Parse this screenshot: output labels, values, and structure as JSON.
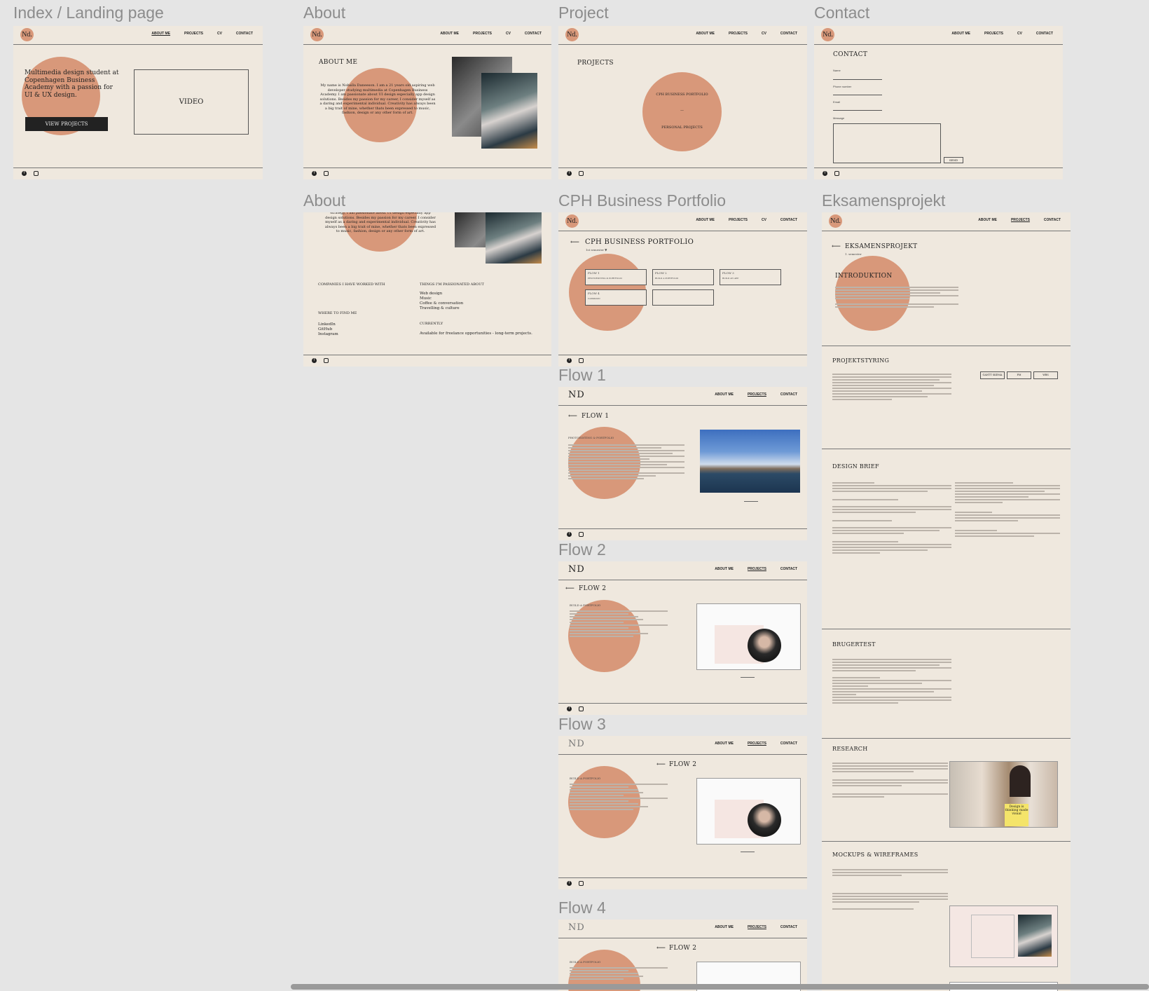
{
  "frame_labels": {
    "index": "Index / Landing page",
    "about1": "About",
    "project": "Project",
    "contact": "Contact",
    "about2": "About",
    "cph": "CPH Business Portfolio",
    "eks": "Eksamensprojekt",
    "flow1": "Flow 1",
    "flow2": "Flow 2",
    "flow3": "Flow 3",
    "flow4": "Flow 4"
  },
  "brand": {
    "logo": "Nd.",
    "accent": "#d8987a",
    "background": "#efe8de"
  },
  "nav": {
    "about": "ABOUT ME",
    "projects": "PROJECTS",
    "cv": "CV",
    "contact": "CONTACT"
  },
  "footer": {
    "icons": [
      "facebook-icon",
      "instagram-icon"
    ]
  },
  "index": {
    "tagline": "Multimedia design student at Copenhagen Business Academy with a passion for UI & UX design.",
    "cta": "VIEW PROJECTS",
    "video": "VIDEO"
  },
  "about": {
    "title": "ABOUT ME",
    "bio": "My name is Nohalla Daneeson. I am a 21 years old aspiring web developer studying multimedia at Copenhagen Business Academy. I am passionate about UI design especially app design solutions. Besides my passion for my career, I consider myself as a daring and experimental individual. Creativity has always been a big trait of mine, whether thats been expressed to music, fashion, design or any other form of art.",
    "bio_top": "strategy, I am passionate about UI design especially app design solutions. Besides my passion for my career, I consider myself as a daring and experimental individual. Creativity has always been a big trait of mine, whether thats been expressed to music, fashion, design or any other form of art.",
    "companies_h": "COMPANIES I HAVE WORKED WITH",
    "passion_h": "THINGS I'M PASSIONATED ABOUT",
    "passions": [
      "Web design",
      "Music",
      "Coffee & conversation",
      "Travelling & culture"
    ],
    "find_h": "WHERE TO FIND ME",
    "find": [
      "LinkedIn",
      "GitHub",
      "Instagram"
    ],
    "current_h": "CURRENTLY",
    "current": "Available for freelance opportunities - long-term projects."
  },
  "projects": {
    "title": "PROJECTS",
    "item1": "CPH BUSINESS PORTFOLIO",
    "divider": "—",
    "item2": "PERSONAL PROJECTS"
  },
  "contact": {
    "title": "CONTACT",
    "name": "Name",
    "phone": "Phone number",
    "email": "Email",
    "message": "Message",
    "send": "SEND"
  },
  "cph": {
    "title": "CPH BUSINESS PORTFOLIO",
    "semester": "1st semester",
    "flows": [
      {
        "label": "FLOW 1",
        "sub": "PHOTOEDITING & PORTFOLIO"
      },
      {
        "label": "FLOW 2",
        "sub": "BUILD A PORTFOLIO"
      },
      {
        "label": "FLOW 3",
        "sub": "BUILD AN APP"
      },
      {
        "label": "FLOW 4",
        "sub": "CAMPAIGN"
      }
    ]
  },
  "flow1": {
    "title": "FLOW 1",
    "heading": "PHOTOEDITING & PORTFOLIO",
    "logo": "ND"
  },
  "flow2": {
    "title": "FLOW 2",
    "heading": "BUILD A PORTFOLIO"
  },
  "flow3": {
    "title": "FLOW 2",
    "heading": "BUILD A PORTFOLIO"
  },
  "flow4": {
    "title": "FLOW 2",
    "heading": "BUILD A PORTFOLIO"
  },
  "eks": {
    "title": "EKSAMENSPROJEKT",
    "semester": "1. semester",
    "intro": "INTRODUKTION",
    "projektstyring": "PROJEKTSTYRING",
    "ps_buttons": [
      "GANTT SKEMA",
      "PM",
      "WBS"
    ],
    "design_brief": "DESIGN BRIEF",
    "brugertest": "BRUGERTEST",
    "research": "RESEARCH",
    "mockups": "MOCKUPS & WIREFRAMES",
    "moodboard_text": "Design is thinking made visual"
  }
}
